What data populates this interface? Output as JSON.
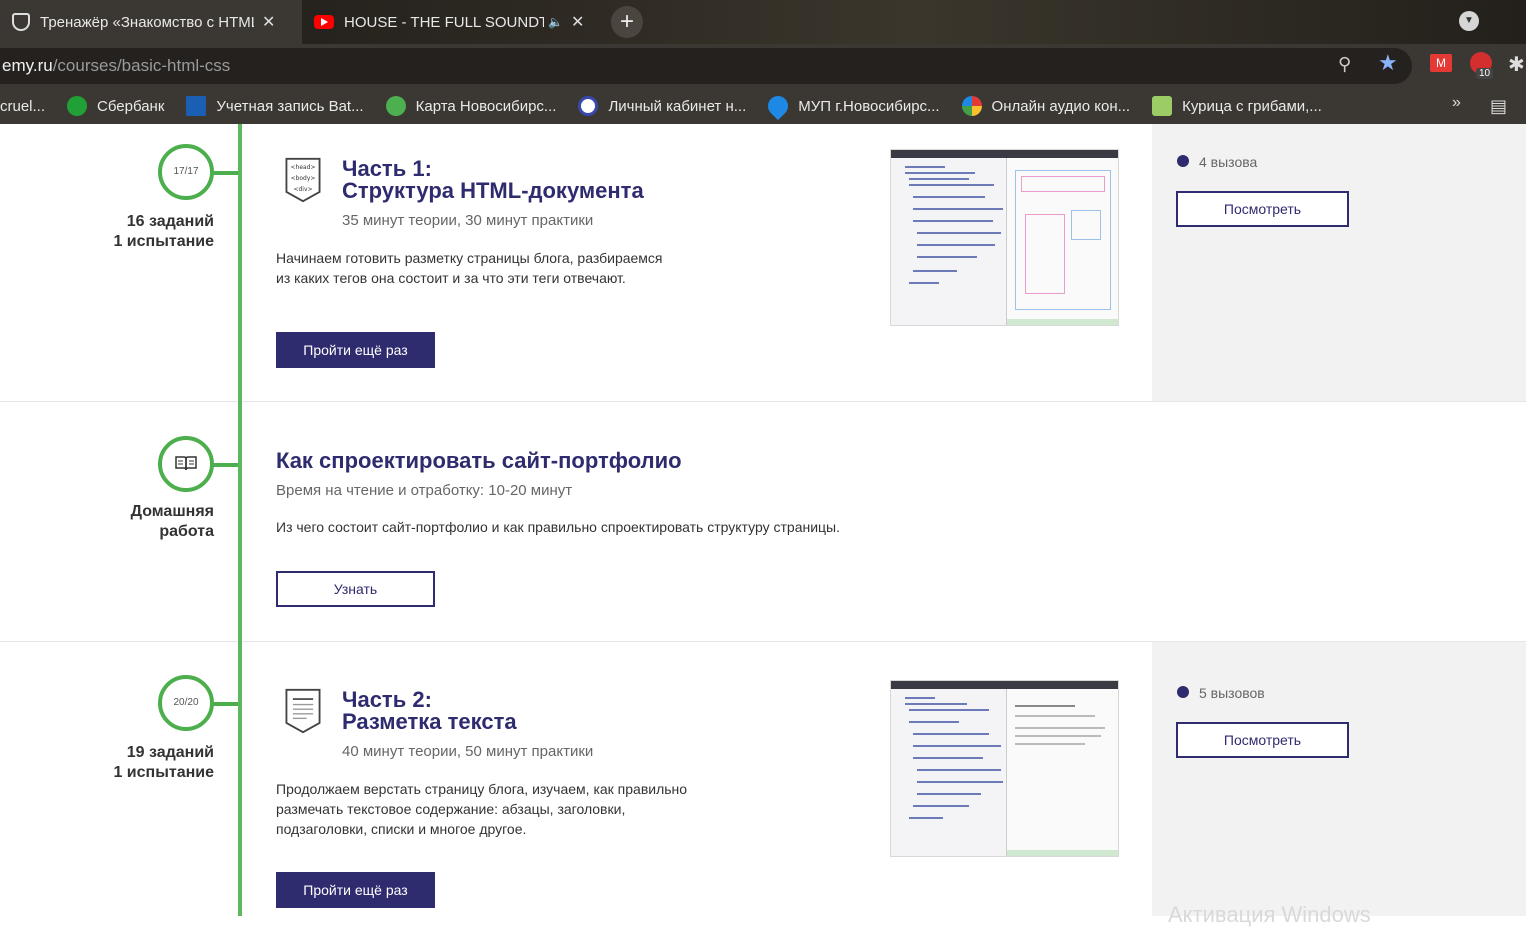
{
  "browser": {
    "tabs": [
      {
        "title": "Тренажёр «Знакомство с HTML",
        "close": "✕"
      },
      {
        "title": "HOUSE - THE FULL SOUNDT",
        "close": "✕"
      }
    ],
    "new_tab": "+",
    "url_domain": "emy.ru",
    "url_path": "/courses/basic-html-css",
    "extension_badge": "10",
    "bookmarks": [
      {
        "label": "cruel...",
        "icon": "bookmark-icon",
        "color": "#3b3732"
      },
      {
        "label": "Сбербанк",
        "icon": "sberbank-icon",
        "color": "#21a038"
      },
      {
        "label": "Учетная запись Bat...",
        "icon": "battlenet-icon",
        "color": "#1a5fb4"
      },
      {
        "label": "Карта Новосибирс...",
        "icon": "map-pin-icon",
        "color": "#4caf50"
      },
      {
        "label": "Личный кабинет н...",
        "icon": "tax-icon",
        "color": "#3949ab"
      },
      {
        "label": "МУП г.Новосибирс...",
        "icon": "water-drop-icon",
        "color": "#1e88e5"
      },
      {
        "label": "Онлайн аудио кон...",
        "icon": "audio-converter-icon",
        "color": "#e53935"
      },
      {
        "label": "Курица с грибами,...",
        "icon": "recipe-icon",
        "color": "#7cb342"
      }
    ],
    "bookmarks_more": "»"
  },
  "lessons": [
    {
      "progress": "17/17",
      "stats_line1": "16 заданий",
      "stats_line2": "1 испытание",
      "icon_labels": [
        "<head>",
        "<body>",
        "<div>"
      ],
      "title_line1": "Часть 1:",
      "title_line2": "Структура HTML-документа",
      "meta": "35 минут теории, 30 минут практики",
      "desc_line1": "Начинаем готовить разметку страницы блога, разбираемся",
      "desc_line2": "из каких тегов она состоит и за что эти теги отвечают.",
      "button": "Пройти ещё раз",
      "challenges": "4 вызова",
      "side_button": "Посмотреть"
    },
    {
      "stats_line1": "Домашняя",
      "stats_line2": "работа",
      "title": "Как спроектировать сайт-портфолио",
      "meta": "Время на чтение и отработку: 10-20 минут",
      "desc": "Из чего состоит сайт-портфолио и как правильно спроектировать структуру страницы.",
      "button": "Узнать"
    },
    {
      "progress": "20/20",
      "stats_line1": "19 заданий",
      "stats_line2": "1 испытание",
      "title_line1": "Часть 2:",
      "title_line2": "Разметка текста",
      "meta": "40 минут теории, 50 минут практики",
      "desc_line1": "Продолжаем верстать страницу блога, изучаем, как правильно",
      "desc_line2": "размечать текстовое содержание: абзацы, заголовки,",
      "desc_line3": "подзаголовки, списки и многое другое.",
      "button": "Пройти ещё раз",
      "challenges": "5 вызовов",
      "side_button": "Посмотреть"
    }
  ],
  "watermark": "Активация Windows",
  "colors": {
    "accent": "#2e2b6f",
    "timeline": "#5cb85c",
    "side_bg": "#f2f2f2"
  }
}
